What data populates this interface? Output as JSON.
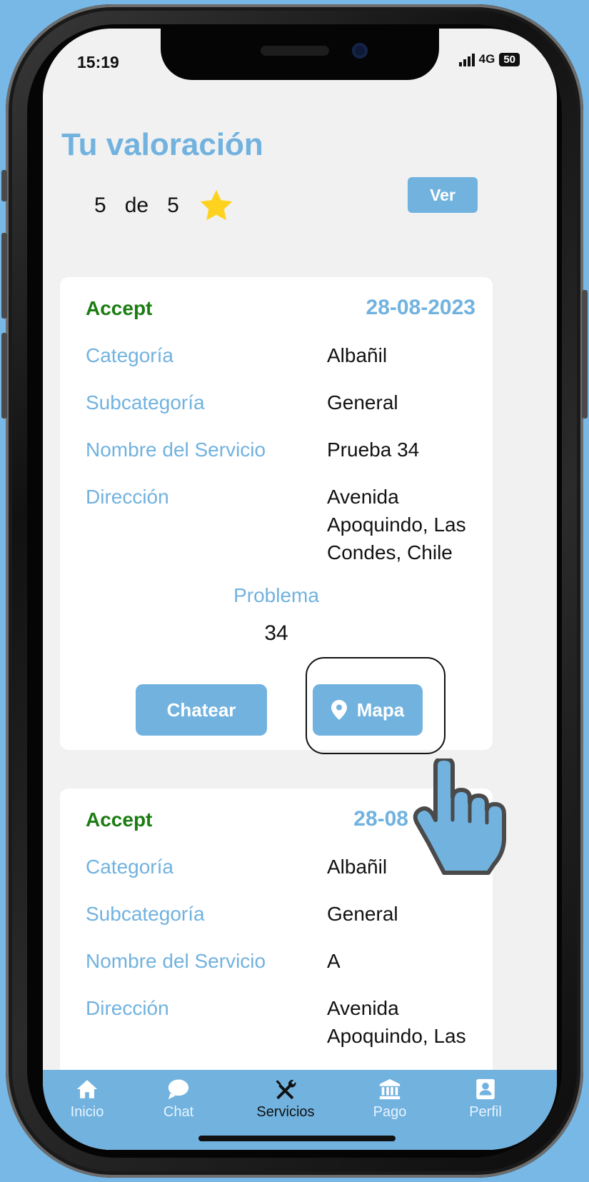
{
  "status_bar": {
    "time": "15:19",
    "network": "4G",
    "battery": "50"
  },
  "rating": {
    "title": "Tu valoración",
    "score": "5",
    "of_label": "de",
    "max": "5",
    "view_button": "Ver"
  },
  "services": [
    {
      "status": "Accept",
      "date": "28-08-2023",
      "rows": [
        {
          "label": "Categoría",
          "value": "Albañil"
        },
        {
          "label": "Subcategoría",
          "value": "General"
        },
        {
          "label": "Nombre del Servicio",
          "value": "Prueba 34"
        },
        {
          "label": "Dirección",
          "value": "Avenida Apoquindo, Las Condes, Chile"
        }
      ],
      "problem_label": "Problema",
      "problem_value": "34",
      "chat_button": "Chatear",
      "map_button": "Mapa"
    },
    {
      "status": "Accept",
      "date": "28-08",
      "rows": [
        {
          "label": "Categoría",
          "value": "Albañil"
        },
        {
          "label": "Subcategoría",
          "value": "General"
        },
        {
          "label": "Nombre del Servicio",
          "value": "A"
        },
        {
          "label": "Dirección",
          "value": "Avenida Apoquindo, Las"
        }
      ]
    }
  ],
  "tabs": [
    {
      "label": "Inicio",
      "icon": "home-icon"
    },
    {
      "label": "Chat",
      "icon": "chat-bubble-icon"
    },
    {
      "label": "Servicios",
      "icon": "tools-icon",
      "active": true
    },
    {
      "label": "Pago",
      "icon": "bank-icon"
    },
    {
      "label": "Perfil",
      "icon": "profile-card-icon"
    }
  ],
  "colors": {
    "accent": "#71b2df",
    "status_green": "#1b7c12",
    "background": "#77b8e6",
    "star": "#ffd21f"
  }
}
